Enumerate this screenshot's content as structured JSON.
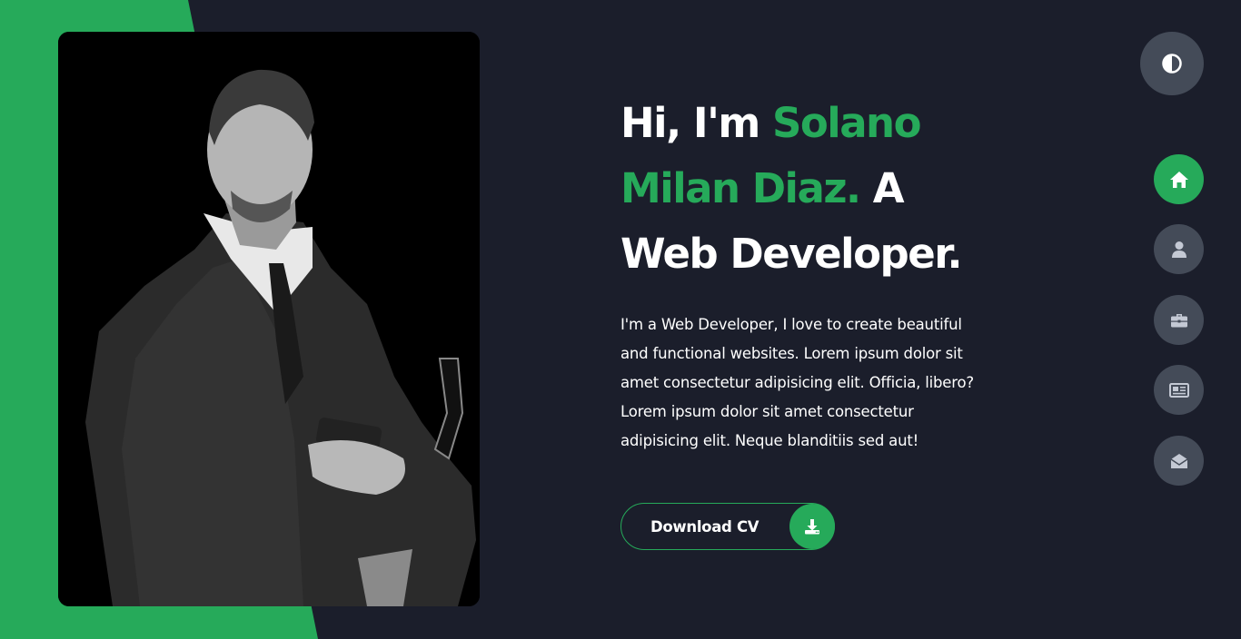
{
  "hero": {
    "greeting": "Hi, I'm ",
    "name": "Solano Milan Diaz.",
    "role_line": " A Web Developer.",
    "intro": "I'm a Web Developer, I love to create beautiful and functional websites. Lorem ipsum dolor sit amet consectetur adipisicing elit. Officia, libero? Lorem ipsum dolor sit amet consectetur adipisicing elit. Neque blanditiis sed aut!",
    "cv_button": "Download CV"
  },
  "nav": {
    "items": [
      {
        "id": "home",
        "icon": "home-icon",
        "active": true
      },
      {
        "id": "about",
        "icon": "user-icon",
        "active": false
      },
      {
        "id": "portfolio",
        "icon": "briefcase-icon",
        "active": false
      },
      {
        "id": "blog",
        "icon": "newspaper-icon",
        "active": false
      },
      {
        "id": "contact",
        "icon": "envelope-open-icon",
        "active": false
      }
    ],
    "theme_toggle_icon": "contrast-icon"
  },
  "colors": {
    "accent": "#26aa5a",
    "background": "#1b1e2b",
    "button_grey": "#444b58"
  }
}
